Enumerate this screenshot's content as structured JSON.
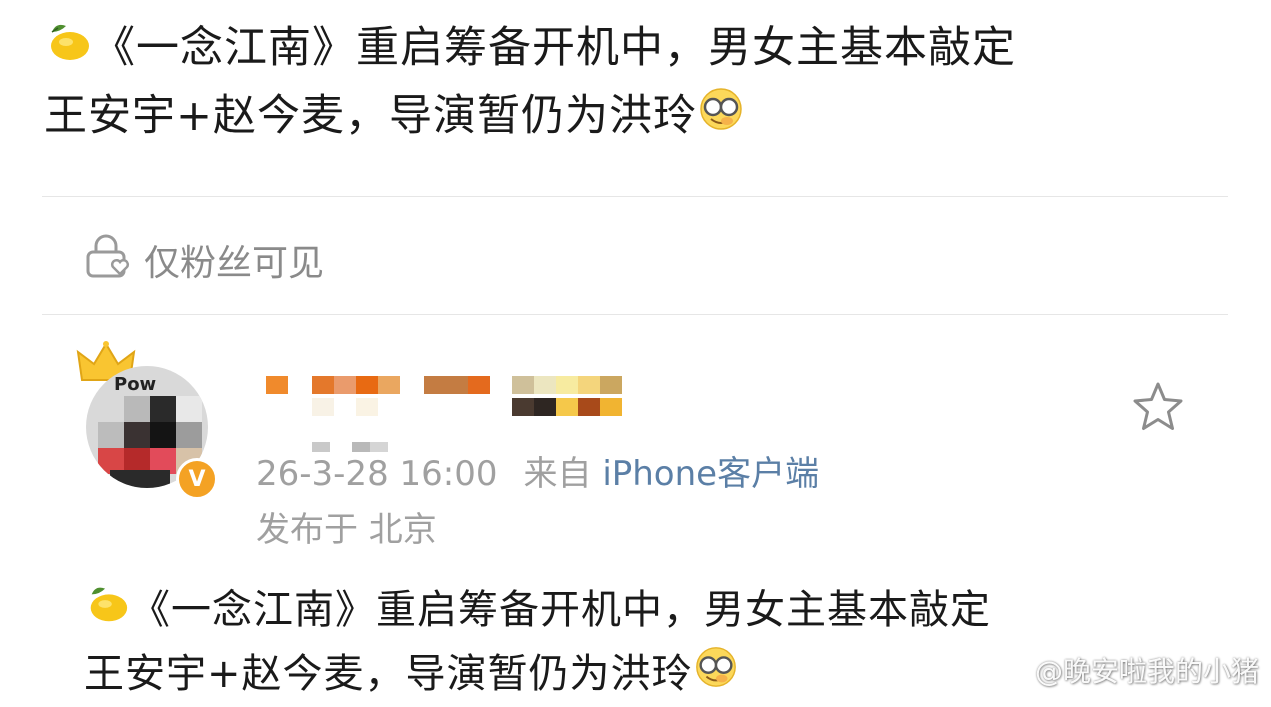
{
  "post": {
    "text_line1": "《一念江南》重启筹备开机中，男女主基本敲定",
    "text_line2": "王安宇+赵今麦，导演暂仍为洪玲",
    "emoji_start": "lemon",
    "emoji_end": "smiling-face-with-monocle"
  },
  "visibility": {
    "label": "仅粉丝可见",
    "icon": "lock-heart-icon"
  },
  "repost": {
    "avatar_text": "Pow",
    "verified_badge": "V",
    "meta": {
      "time": "26-3-28 16:00",
      "source_prefix": "来自",
      "source_client": "iPhone客户端",
      "location": "发布于 北京"
    },
    "text_line1": "《一念江南》重启筹备开机中，男女主基本敲定",
    "text_line2": "王安宇+赵今麦，导演暂仍为洪玲"
  },
  "watermark": {
    "text": "@晚安啦我的小猪"
  },
  "colors": {
    "text": "#1a1a1a",
    "muted": "#a0a0a0",
    "link": "#5b7fa6",
    "verified": "#f4a224",
    "divider": "#e6e6e6"
  }
}
